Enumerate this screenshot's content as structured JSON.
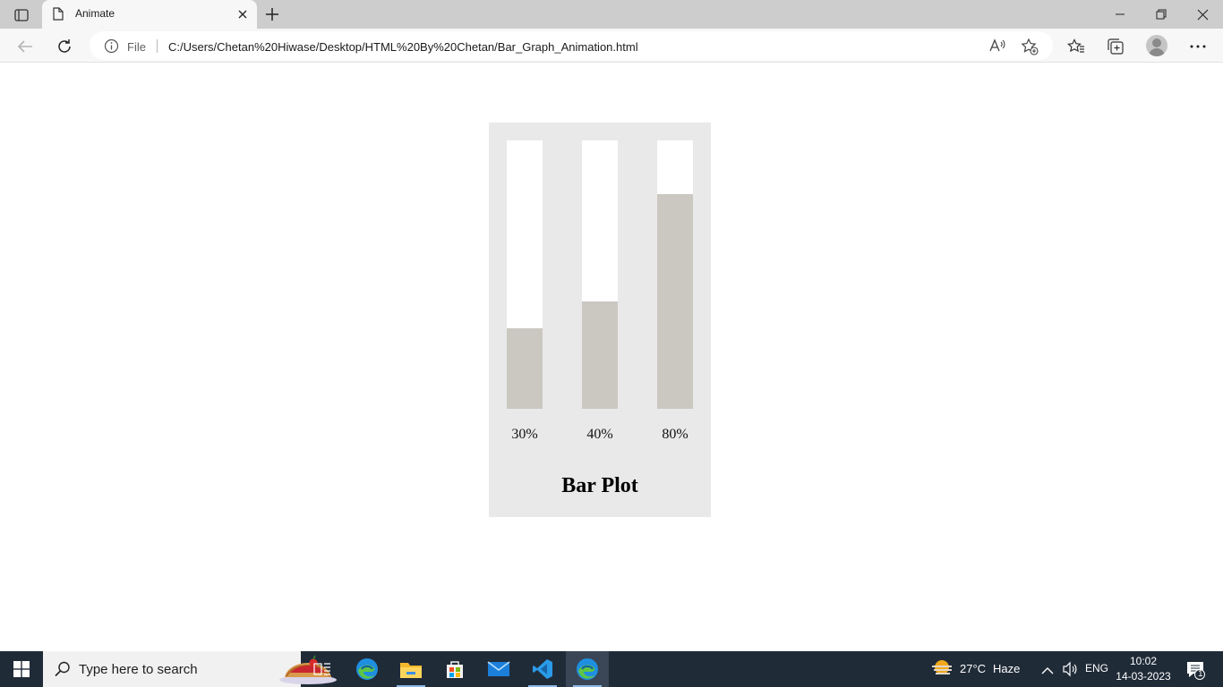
{
  "browser": {
    "tab_title": "Animate",
    "address_scheme_label": "File",
    "url": "C:/Users/Chetan%20Hiwase/Desktop/HTML%20By%20Chetan/Bar_Graph_Animation.html"
  },
  "page": {
    "chart_data": {
      "type": "bar",
      "title": "Bar Plot",
      "categories": [
        "30%",
        "40%",
        "80%"
      ],
      "values": [
        30,
        40,
        80
      ],
      "ylim": [
        0,
        100
      ],
      "bar_color": "#cbc7c1",
      "track_color": "#ffffff",
      "card_color": "#e9e9e9"
    }
  },
  "taskbar": {
    "search_placeholder": "Type here to search",
    "weather_temp": "27°C",
    "weather_desc": "Haze",
    "language": "ENG",
    "time": "10:02",
    "date": "14-03-2023",
    "notification_count": "1",
    "apps": [
      "task-view",
      "edge",
      "file-explorer",
      "store",
      "mail",
      "vscode",
      "edge-active"
    ]
  }
}
